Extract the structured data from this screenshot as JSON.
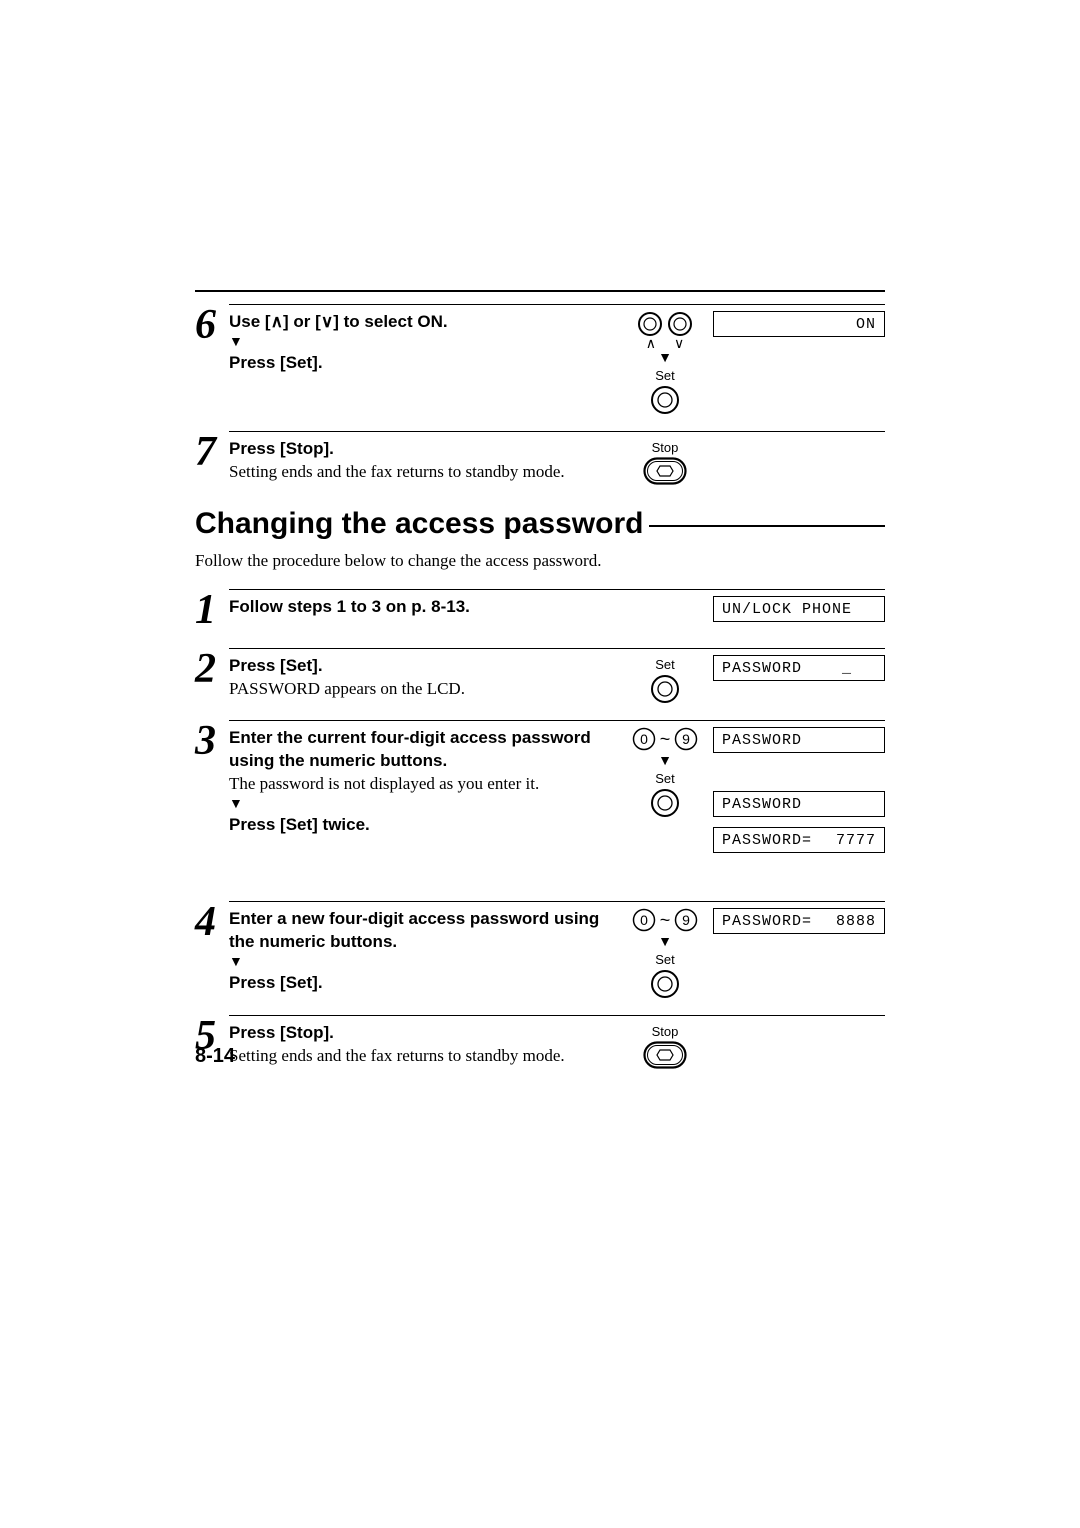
{
  "prev": {
    "step6": {
      "num": "6",
      "line1a": "Use [",
      "line1b": "] or [",
      "line1c": "] to select ON.",
      "line2": "Press [Set].",
      "set_label": "Set",
      "lcd": "ON"
    },
    "step7": {
      "num": "7",
      "line1": "Press [Stop].",
      "line2": "Setting ends and the fax returns to standby mode.",
      "stop_label": "Stop"
    }
  },
  "section": {
    "title": "Changing the access password",
    "intro": "Follow the procedure below to change the access password."
  },
  "steps": {
    "s1": {
      "num": "1",
      "line1": "Follow steps 1 to 3 on p. 8-13.",
      "lcd": "UN/LOCK PHONE"
    },
    "s2": {
      "num": "2",
      "line1": "Press [Set].",
      "line2": "PASSWORD appears on the LCD.",
      "set_label": "Set",
      "lcd": "PASSWORD    _"
    },
    "s3": {
      "num": "3",
      "line1": "Enter the current four-digit access password using the numeric buttons.",
      "line2": "The password is not displayed as you enter it.",
      "line3": "Press [Set] twice.",
      "set_label": "Set",
      "numrange": {
        "zero": "0",
        "tilde": "~",
        "nine": "9"
      },
      "lcd1": "PASSWORD",
      "lcd2": "PASSWORD",
      "lcd3_left": "PASSWORD=",
      "lcd3_right": "7777"
    },
    "s4": {
      "num": "4",
      "line1": "Enter a new four-digit access password using the numeric buttons.",
      "line2": "Press [Set].",
      "set_label": "Set",
      "numrange": {
        "zero": "0",
        "tilde": "~",
        "nine": "9"
      },
      "lcd_left": "PASSWORD=",
      "lcd_right": "8888"
    },
    "s5": {
      "num": "5",
      "line1": "Press [Stop].",
      "line2": "Setting ends and the fax returns to standby mode.",
      "stop_label": "Stop"
    }
  },
  "page_number": "8-14",
  "glyphs": {
    "up": "∧",
    "down": "∨",
    "downarrow": "▼"
  }
}
